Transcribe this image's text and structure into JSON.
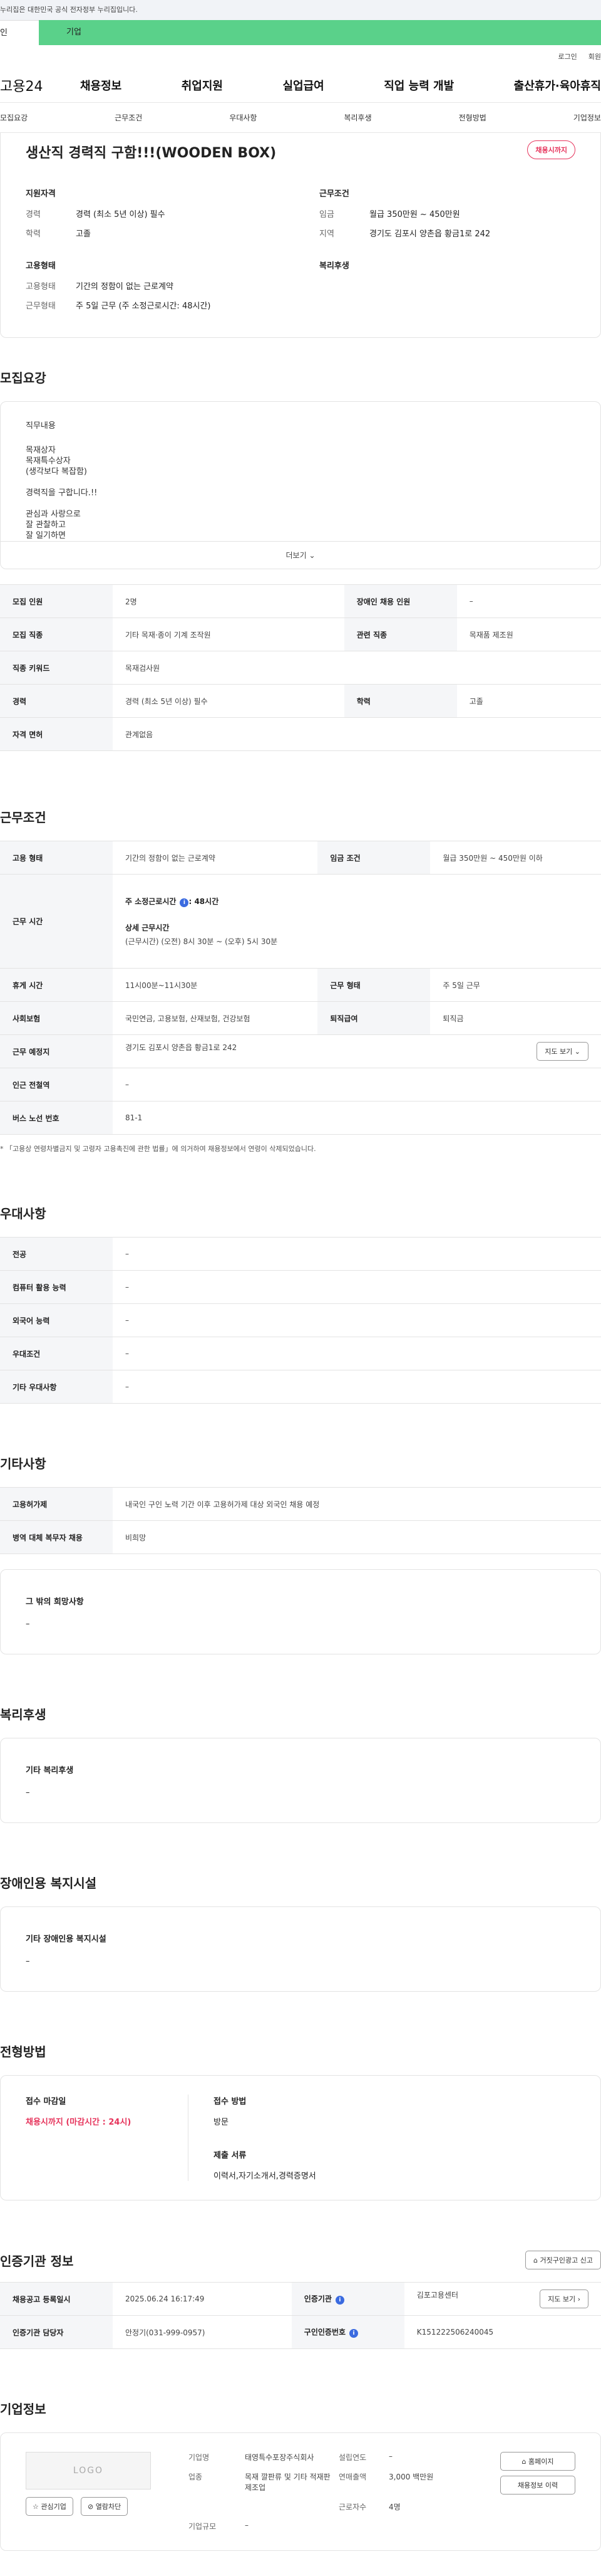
{
  "gov_bar": "누리집은 대한민국 공식 전자정부 누리집입니다.",
  "top_tabs": {
    "personal": "인",
    "company": "기업"
  },
  "util": {
    "login": "로그인",
    "signup": "회원"
  },
  "gnb": {
    "logo": "고용24",
    "menu": [
      "채용정보",
      "취업지원",
      "실업급여",
      "직업 능력 개발",
      "출산휴가·육아휴직"
    ]
  },
  "snb": [
    "모집요강",
    "근무조건",
    "우대사항",
    "복리후생",
    "전형방법",
    "기업정보"
  ],
  "job": {
    "title": "생산직 경력직 구함!!!(WOODEN BOX)",
    "badge": "채용시까지",
    "qualification_title": "지원자격",
    "career_label": "경력",
    "career_value": "경력 (최소 5년 이상) 필수",
    "education_label": "학력",
    "education_value": "고졸",
    "conditions_title": "근무조건",
    "wage_label": "임금",
    "wage_value": "월급 350만원 ~ 450만원",
    "region_label": "지역",
    "region_value": "경기도 김포시 양촌읍 황금1로 242",
    "employ_title": "고용형태",
    "employ_type_label": "고용형태",
    "employ_type_value": "기간의 정함이 없는 근로계약",
    "work_type_label": "근무형태",
    "work_type_value": "주 5일 근무 (주 소정근로시간: 48시간)",
    "welfare_title": "복리후생"
  },
  "recruit": {
    "section_title": "모집요강",
    "desc_heading": "직무내용",
    "desc_lines": [
      "목재상자",
      "목재특수상자",
      "(생각보다 복잡함)",
      "",
      "경력직을 구합니다.!!",
      "",
      "관심과 사랑으로",
      "잘 관찰하고",
      "잘 일기하면"
    ],
    "more": "더보기",
    "table": {
      "headcount_k": "모집 인원",
      "headcount_v": "2명",
      "disabled_k": "장애인 채용 인원",
      "disabled_v": "–",
      "job_k": "모집 직종",
      "job_v": "기타 목재·종이 기계 조작원",
      "related_k": "관련 직종",
      "related_v": "목재품 제조원",
      "keyword_k": "직종 키워드",
      "keyword_v": "목재검사원",
      "career_k": "경력",
      "career_v": "경력 (최소 5년 이상) 필수",
      "edu_k": "학력",
      "edu_v": "고졸",
      "license_k": "자격 면허",
      "license_v": "관계없음"
    }
  },
  "work": {
    "section_title": "근무조건",
    "employ_k": "고용 형태",
    "employ_v": "기간의 정함이 없는 근로계약",
    "wage_k": "임금 조건",
    "wage_v": "월급 350만원 ~ 450만원 이하",
    "hours_k": "근무 시간",
    "hours_week_label": "주 소정근로시간",
    "hours_week_value": "48시간",
    "hours_detail_label": "상세 근무시간",
    "hours_detail_value": "(근무시간) (오전) 8시 30분 ~ (오후) 5시 30분",
    "break_k": "휴게 시간",
    "break_v": "11시00분~11시30분",
    "worktype_k": "근무 형태",
    "worktype_v": "주 5일 근무",
    "insurance_k": "사회보험",
    "insurance_v": "국민연금, 고용보험, 산재보험, 건강보험",
    "severance_k": "퇴직급여",
    "severance_v": "퇴직금",
    "place_k": "근무 예정지",
    "place_v": "경기도 김포시 양촌읍 황금1로 242",
    "map_button": "지도 보기",
    "subway_k": "인근 전철역",
    "subway_v": "–",
    "bus_k": "버스 노선 번호",
    "bus_v": "81-1",
    "note": "* 「고용상 연령차별금지 및 고령자 고용촉진에 관한 법률」에 의거하여 채용정보에서 연령이 삭제되었습니다."
  },
  "pref": {
    "section_title": "우대사항",
    "major_k": "전공",
    "major_v": "–",
    "computer_k": "컴퓨터 활용 능력",
    "computer_v": "–",
    "language_k": "외국어 능력",
    "language_v": "–",
    "cond_k": "우대조건",
    "cond_v": "–",
    "etc_k": "기타 우대사항",
    "etc_v": "–"
  },
  "other": {
    "section_title": "기타사항",
    "employ_permit_k": "고용허가제",
    "employ_permit_v": "내국인 구인 노력 기간 이후 고용허가제 대상 외국인 채용 예정",
    "military_k": "병역 대체 복무자 채용",
    "military_v": "비희망",
    "wish_title": "그 밖의 희망사항",
    "wish_v": "–"
  },
  "welfare": {
    "section_title": "복리후생",
    "etc_title": "기타 복리후생",
    "etc_v": "–"
  },
  "disability": {
    "section_title": "장애인용 복지시설",
    "etc_title": "기타 장애인용 복지시설",
    "etc_v": "–"
  },
  "selection": {
    "section_title": "전형방법",
    "deadline_title": "접수 마감일",
    "deadline_v": "채용시까지 (마감시간 : 24시)",
    "method_title": "접수 방법",
    "method_v": "방문",
    "docs_title": "제출 서류",
    "docs_v": "이력서,자기소개서,경력증명서"
  },
  "agency": {
    "section_title": "인증기관 정보",
    "report_button": "거짓구인광고 신고",
    "reg_k": "채용공고 등록일시",
    "reg_v": "2025.06.24 16:17:49",
    "org_k": "인증기관",
    "org_v": "김포고용센터",
    "org_button": "지도 보기",
    "manager_k": "인증기관 담당자",
    "manager_v": "안정기(031-999-0957)",
    "no_k": "구인인증번호",
    "no_v": "K151222506240045"
  },
  "company": {
    "section_title": "기업정보",
    "logo": "LOGO",
    "fav_button": "관심기업",
    "block_button": "열람차단",
    "name_k": "기업명",
    "name_v": "태영특수포장주식회사",
    "founded_k": "설립연도",
    "founded_v": "–",
    "industry_k": "업종",
    "industry_v": "목재 깔판류 및 기타 적재판 제조업",
    "sales_k": "연매출액",
    "sales_v": "3,000 백만원",
    "employees_k": "근로자수",
    "employees_v": "4명",
    "size_k": "기업규모",
    "size_v": "–",
    "home_button": "홈페이지",
    "history_button": "채용정보 이력"
  }
}
